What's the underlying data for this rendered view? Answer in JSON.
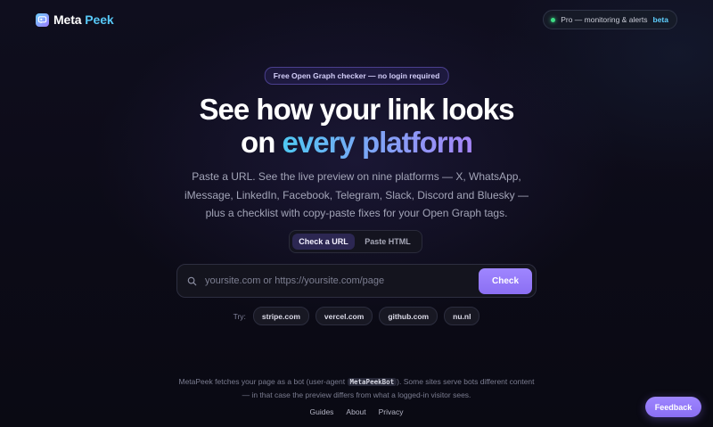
{
  "header": {
    "logo": {
      "icon": "chat-bubble-icon",
      "name_part1": "Meta",
      "name_part2": "Peek"
    },
    "pro_badge": {
      "text": "Pro — monitoring & alerts",
      "tag": "beta",
      "dot_color": "#3ddc84"
    }
  },
  "hero": {
    "announcement": "Free Open Graph checker — no login required",
    "title_line1": "See how your link looks",
    "title_line2_prefix": "on",
    "title_line2_highlight": "every platform",
    "subtitle": "Paste a URL. See the live preview on nine platforms — X, WhatsApp, iMessage, LinkedIn, Facebook, Telegram, Slack, Discord and Bluesky — plus a checklist with copy-paste fixes for your Open Graph tags."
  },
  "mode_switch": {
    "options": [
      {
        "label": "Check a URL",
        "active": true
      },
      {
        "label": "Paste HTML",
        "active": false
      }
    ]
  },
  "search": {
    "icon": "search-icon",
    "placeholder": "yoursite.com or https://yoursite.com/page",
    "value": "",
    "button_label": "Check"
  },
  "try": {
    "label": "Try:",
    "examples": [
      "stripe.com",
      "vercel.com",
      "github.com",
      "nu.nl"
    ]
  },
  "footer": {
    "disclaimer_before": "MetaPeek fetches your page as a bot (user-agent",
    "user_agent": "MetaPeekBot",
    "disclaimer_after": "). Some sites serve bots different content — in that case the preview differs from what a logged-in visitor sees.",
    "links": [
      "Guides",
      "About",
      "Privacy"
    ]
  },
  "feedback_button": "Feedback",
  "colors": {
    "accent_purple": "#8b6ff3",
    "accent_cyan": "#57c8f6",
    "background": "#0d0c18"
  }
}
